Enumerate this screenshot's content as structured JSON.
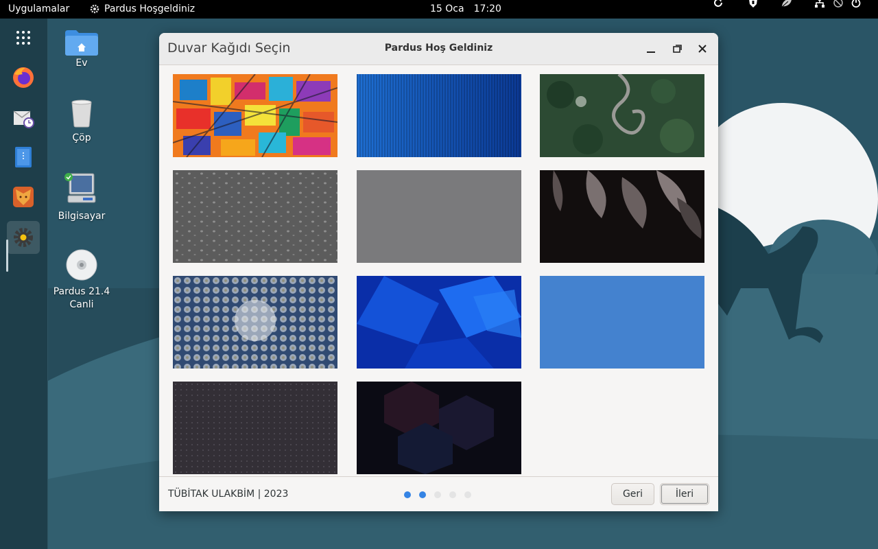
{
  "topbar": {
    "apps_label": "Uygulamalar",
    "active_app": "Pardus Hoşgeldiniz",
    "date": "15 Oca",
    "time": "17:20",
    "tray_icons": [
      "refresh-icon",
      "shield-icon",
      "leaf-icon",
      "network-icon",
      "mute-icon",
      "power-icon"
    ]
  },
  "dock": {
    "items": [
      "app-grid-icon",
      "firefox-icon",
      "mail-clock-icon",
      "file-manager-icon",
      "lion-app-icon",
      "settings-gear-icon"
    ]
  },
  "desktop": {
    "icons": [
      {
        "label": "Ev"
      },
      {
        "label": "Çöp"
      },
      {
        "label": "Bilgisayar"
      },
      {
        "label": "Pardus 21.4\nCanli"
      }
    ]
  },
  "window": {
    "left_title": "Duvar Kağıdı Seçin",
    "center_title": "Pardus Hoş Geldiniz",
    "footer_credit": "TÜBİTAK ULAKBİM | 2023",
    "pagination": {
      "total": 5,
      "active": [
        0,
        1
      ]
    },
    "back_button": "Geri",
    "next_button": "İleri",
    "wallpapers": [
      "abstract-colorful-painting",
      "blue-vertical-stripes",
      "winding-forest-road",
      "gray-droplets",
      "plain-gray",
      "dark-leaves",
      "snowy-forest-aerial",
      "blue-geometric-shapes",
      "blue-texture",
      "dark-dotted",
      "dark-hexagons"
    ]
  },
  "colors": {
    "accent": "#3584e4",
    "desktop_teal": "#254b5a",
    "dock": "#1e3e4a"
  }
}
